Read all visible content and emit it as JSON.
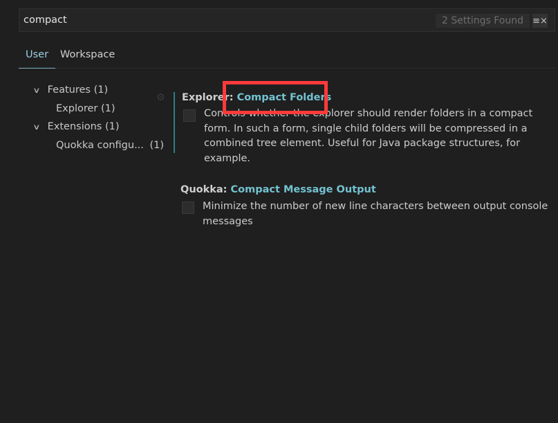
{
  "search": {
    "value": "compact",
    "result_count": "2 Settings Found",
    "clear_icon": "clear-filter-icon"
  },
  "tabs": [
    {
      "label": "User",
      "active": true
    },
    {
      "label": "Workspace",
      "active": false
    }
  ],
  "toc": [
    {
      "label": "Features",
      "count": "(1)",
      "expanded": true
    },
    {
      "label": "Explorer",
      "count": "(1)"
    },
    {
      "label": "Extensions",
      "count": "(1)",
      "expanded": true
    },
    {
      "label": "Quokka configu...",
      "count": "(1)"
    }
  ],
  "settings": [
    {
      "category": "Explorer: ",
      "name": "Compact Folders",
      "description": "Controls whether the explorer should render folders in a compact form. In such a form, single child folders will be compressed in a combined tree element. Useful for Java package structures, for example.",
      "checked": false
    },
    {
      "category": "Quokka: ",
      "name": "Compact Message Output",
      "description": "Minimize the number of new line characters between output console messages",
      "checked": false
    }
  ],
  "colors": {
    "background": "#1f1f1f",
    "accent": "#73c2d0",
    "annotation": "#ff3a3a"
  }
}
